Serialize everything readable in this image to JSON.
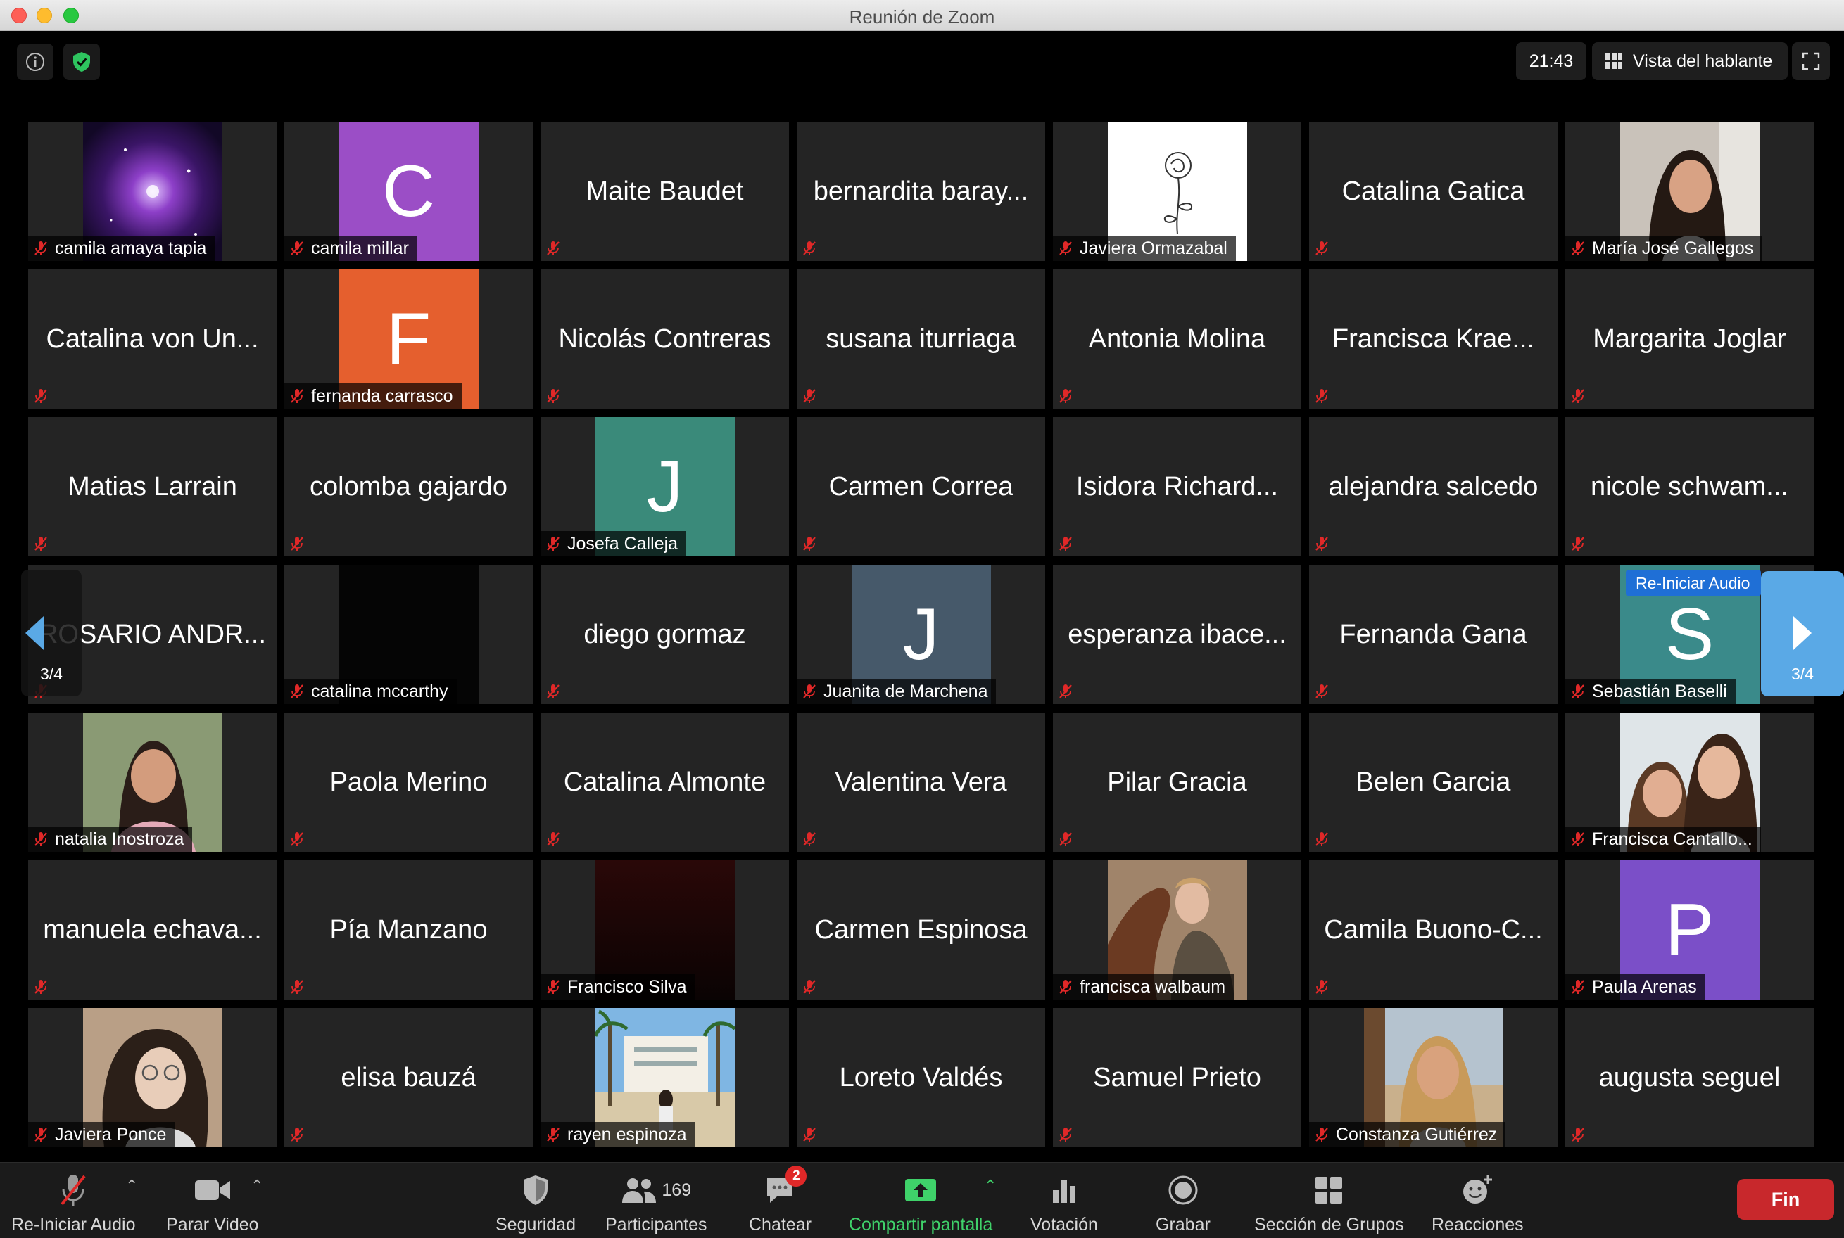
{
  "window": {
    "title": "Reunión de Zoom"
  },
  "topbar": {
    "clock": "21:43",
    "view_label": "Vista del hablante"
  },
  "page_nav": {
    "left_count": "3/4",
    "right_count": "3/4"
  },
  "tooltip": {
    "text": "Re-Iniciar Audio"
  },
  "tiles": [
    {
      "name": "camila amaya tapia",
      "kind": "photo",
      "photo": "galaxy"
    },
    {
      "name": "camila millar",
      "kind": "avatar",
      "letter": "C",
      "color": "#9b4ec6"
    },
    {
      "name": "Maite Baudet",
      "kind": "text"
    },
    {
      "name": "bernardita baray...",
      "kind": "text"
    },
    {
      "name": "Javiera Ormazabal",
      "kind": "photo",
      "photo": "rose"
    },
    {
      "name": "Catalina Gatica",
      "kind": "text"
    },
    {
      "name": "María José Gallegos",
      "kind": "photo",
      "photo": "portrait-warm"
    },
    {
      "name": "Catalina von Un...",
      "kind": "text"
    },
    {
      "name": "fernanda carrasco",
      "kind": "avatar",
      "letter": "F",
      "color": "#e55f2e"
    },
    {
      "name": "Nicolás Contreras",
      "kind": "text"
    },
    {
      "name": "susana iturriaga",
      "kind": "text"
    },
    {
      "name": "Antonia Molina",
      "kind": "text"
    },
    {
      "name": "Francisca Krae...",
      "kind": "text"
    },
    {
      "name": "Margarita Joglar",
      "kind": "text"
    },
    {
      "name": "Matias Larrain",
      "kind": "text"
    },
    {
      "name": "colomba gajardo",
      "kind": "text"
    },
    {
      "name": "Josefa Calleja",
      "kind": "avatar",
      "letter": "J",
      "color": "#3a8a7a"
    },
    {
      "name": "Carmen Correa",
      "kind": "text"
    },
    {
      "name": "Isidora Richard...",
      "kind": "text"
    },
    {
      "name": "alejandra salcedo",
      "kind": "text"
    },
    {
      "name": "nicole schwam...",
      "kind": "text"
    },
    {
      "name": "ROSARIO ANDR...",
      "kind": "text"
    },
    {
      "name": "catalina mccarthy",
      "kind": "blocked"
    },
    {
      "name": "diego gormaz",
      "kind": "text"
    },
    {
      "name": "Juanita de Marchena",
      "kind": "avatar",
      "letter": "J",
      "color": "#46596a"
    },
    {
      "name": "esperanza ibace...",
      "kind": "text"
    },
    {
      "name": "Fernanda Gana",
      "kind": "text"
    },
    {
      "name": "Sebastián Baselli",
      "kind": "avatar",
      "letter": "S",
      "color": "#3a8a8a"
    },
    {
      "name": "natalia Inostroza",
      "kind": "photo",
      "photo": "portrait-pink"
    },
    {
      "name": "Paola Merino",
      "kind": "text"
    },
    {
      "name": "Catalina Almonte",
      "kind": "text"
    },
    {
      "name": "Valentina Vera",
      "kind": "text"
    },
    {
      "name": "Pilar Gracia",
      "kind": "text"
    },
    {
      "name": "Belen Garcia",
      "kind": "text"
    },
    {
      "name": "Francisca Cantallo...",
      "kind": "photo",
      "photo": "portrait-duo"
    },
    {
      "name": "manuela echava...",
      "kind": "text"
    },
    {
      "name": "Pía Manzano",
      "kind": "text"
    },
    {
      "name": "Francisco Silva",
      "kind": "photo",
      "photo": "dark-red"
    },
    {
      "name": "Carmen Espinosa",
      "kind": "text"
    },
    {
      "name": "francisca walbaum",
      "kind": "photo",
      "photo": "horse"
    },
    {
      "name": "Camila Buono-C...",
      "kind": "text"
    },
    {
      "name": "Paula Arenas",
      "kind": "avatar",
      "letter": "P",
      "color": "#7b4fc8"
    },
    {
      "name": "Javiera Ponce",
      "kind": "photo",
      "photo": "portrait-glasses"
    },
    {
      "name": "elisa bauzá",
      "kind": "text"
    },
    {
      "name": "rayen espinoza",
      "kind": "photo",
      "photo": "palms"
    },
    {
      "name": "Loreto Valdés",
      "kind": "text"
    },
    {
      "name": "Samuel Prieto",
      "kind": "text"
    },
    {
      "name": "Constanza Gutiérrez",
      "kind": "photo",
      "photo": "beach"
    },
    {
      "name": "augusta seguel",
      "kind": "text"
    }
  ],
  "toolbar": {
    "audio_label": "Re-Iniciar Audio",
    "video_label": "Parar Video",
    "security_label": "Seguridad",
    "participants_label": "Participantes",
    "participants_count": "169",
    "chat_label": "Chatear",
    "chat_badge": "2",
    "share_label": "Compartir pantalla",
    "poll_label": "Votación",
    "record_label": "Grabar",
    "breakout_label": "Sección de Grupos",
    "reactions_label": "Reacciones",
    "end_label": "Fin"
  }
}
